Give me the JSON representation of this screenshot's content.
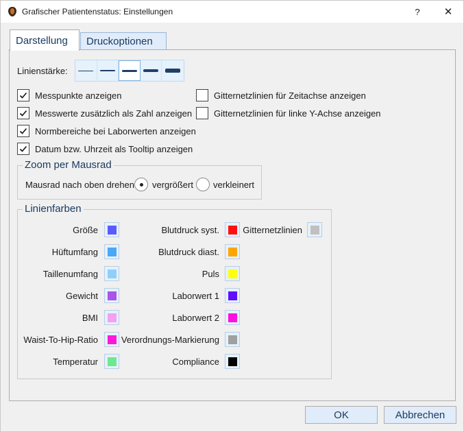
{
  "window": {
    "title": "Grafischer Patientenstatus: Einstellungen",
    "help_label": "?",
    "close_label": "✕"
  },
  "tabs": [
    {
      "label": "Darstellung",
      "active": true
    },
    {
      "label": "Druckoptionen",
      "active": false
    }
  ],
  "line_width": {
    "label": "Linienstärke:",
    "options": [
      "thin",
      "thin-medium",
      "medium",
      "thick",
      "extra-thick"
    ],
    "selected_index": 2
  },
  "checkboxes_left": [
    {
      "label": "Messpunkte anzeigen",
      "checked": true
    },
    {
      "label": "Messwerte zusätzlich als Zahl anzeigen",
      "checked": true
    },
    {
      "label": "Normbereiche bei Laborwerten anzeigen",
      "checked": true
    },
    {
      "label": "Datum bzw. Uhrzeit als Tooltip anzeigen",
      "checked": true
    }
  ],
  "checkboxes_right": [
    {
      "label": "Gitternetzlinien für Zeitachse anzeigen",
      "checked": false
    },
    {
      "label": "Gitternetzlinien für linke Y-Achse anzeigen",
      "checked": false
    }
  ],
  "zoom": {
    "title": "Zoom per Mausrad",
    "label": "Mausrad nach oben drehen",
    "options": [
      {
        "label": "vergrößert",
        "selected": true
      },
      {
        "label": "verkleinert",
        "selected": false
      }
    ]
  },
  "colors": {
    "title": "Linienfarben",
    "col1": [
      {
        "label": "Größe",
        "color": "#5a5aff"
      },
      {
        "label": "Hüftumfang",
        "color": "#4aa8f5"
      },
      {
        "label": "Taillenumfang",
        "color": "#8fd0f8"
      },
      {
        "label": "Gewicht",
        "color": "#a855e8"
      },
      {
        "label": "BMI",
        "color": "#f5a0f0"
      },
      {
        "label": "Waist-To-Hip-Ratio",
        "color": "#ff18d8"
      },
      {
        "label": "Temperatur",
        "color": "#6ee88e"
      }
    ],
    "col2": [
      {
        "label": "Blutdruck syst.",
        "color": "#ff1010"
      },
      {
        "label": "Blutdruck diast.",
        "color": "#ffa500"
      },
      {
        "label": "Puls",
        "color": "#ffff10"
      },
      {
        "label": "Laborwert 1",
        "color": "#6010ff"
      },
      {
        "label": "Laborwert 2",
        "color": "#ff10e0"
      },
      {
        "label": "Verordnungs-Markierung",
        "color": "#a0a0a0"
      },
      {
        "label": "Compliance",
        "color": "#000000"
      }
    ],
    "col3": [
      {
        "label": "Gitternetzlinien",
        "color": "#c0c0c0"
      }
    ]
  },
  "buttons": {
    "ok": "OK",
    "cancel": "Abbrechen"
  }
}
